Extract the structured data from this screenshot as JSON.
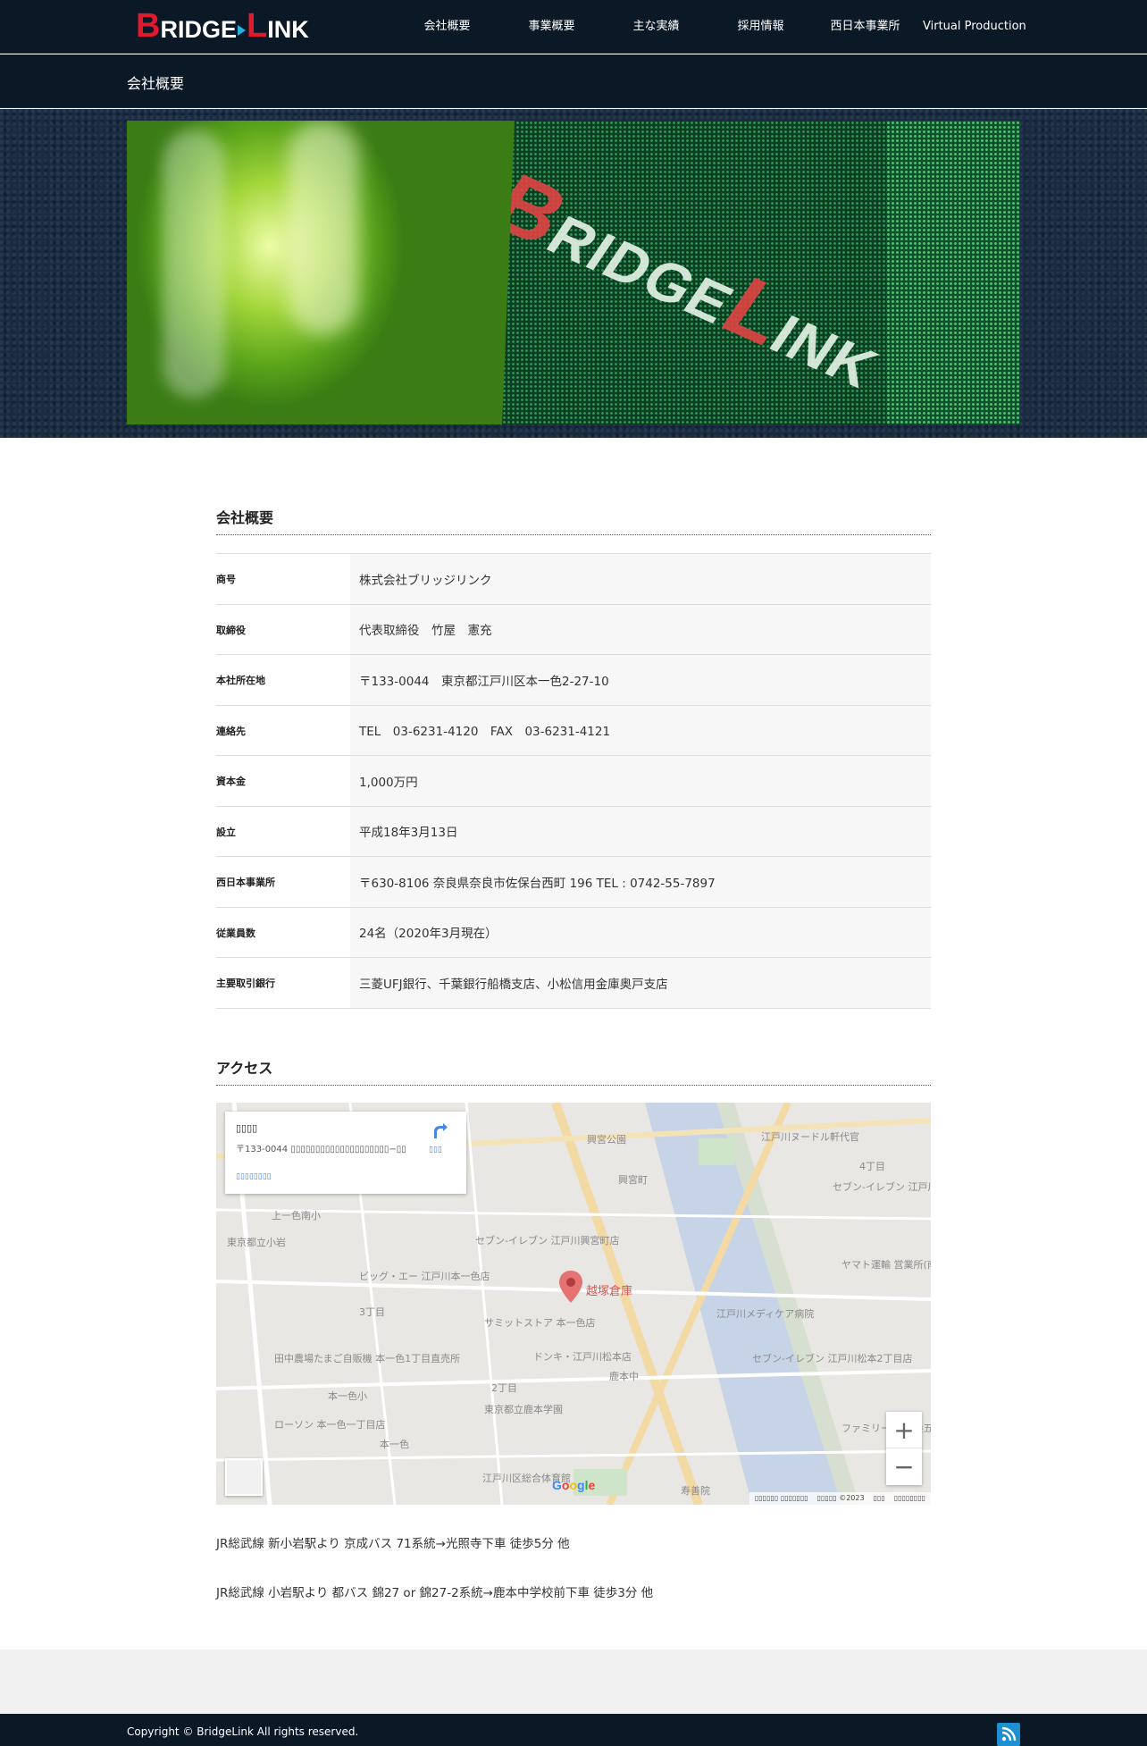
{
  "header": {
    "logo_text": "BridgeLink",
    "nav": [
      {
        "label": "会社概要"
      },
      {
        "label": "事業概要"
      },
      {
        "label": "主な実績"
      },
      {
        "label": "採用情報"
      },
      {
        "label": "西日本事業所"
      },
      {
        "label": "Virtual Production"
      }
    ]
  },
  "page_title": "会社概要",
  "company": {
    "heading": "会社概要",
    "rows": [
      {
        "label": "商号",
        "value": "株式会社ブリッジリンク"
      },
      {
        "label": "取締役",
        "value": "代表取締役　竹屋　憲充"
      },
      {
        "label": "本社所在地",
        "value": "〒133-0044　東京都江戸川区本一色2-27-10"
      },
      {
        "label": "連絡先",
        "value": "TEL　03-6231-4120　FAX　03-6231-4121"
      },
      {
        "label": "資本金",
        "value": "1,000万円"
      },
      {
        "label": "設立",
        "value": "平成18年3月13日"
      },
      {
        "label": "西日本事業所",
        "value": "〒630-8106 奈良県奈良市佐保台西町 196 TEL : 0742-55-7897"
      },
      {
        "label": "従業員数",
        "value": "24名（2020年3月現在）"
      },
      {
        "label": "主要取引銀行",
        "value": "三菱UFJ銀行、千葉銀行船橋支店、小松信用金庫奥戸支店"
      }
    ]
  },
  "access": {
    "heading": "アクセス",
    "map": {
      "place_name": "▯▯▯▯",
      "address": "〒133-0044 ▯▯▯▯▯▯▯▯▯▯▯▯▯▯▯▯▯▯▯▯−▯▯",
      "directions_label": "▯▯▯",
      "larger_map_label": "▯▯▯▯▯▯▯▯",
      "pin_label": "越塚倉庫",
      "zoom_in": "+",
      "zoom_out": "−",
      "google_logo": "Google",
      "attribution": [
        "▯▯▯▯▯▯ ▯▯▯▯▯▯▯",
        "▯▯▯▯▯ ©2023",
        "▯▯▯",
        "▯▯▯▯▯▯▯▯"
      ],
      "labels": [
        {
          "text": "興宮公園"
        },
        {
          "text": "興宮町"
        },
        {
          "text": "江戸川ヌードル軒代官"
        },
        {
          "text": "4丁目"
        },
        {
          "text": "セブン-イレブン 江戸川二枚橋店"
        },
        {
          "text": "上一色南小"
        },
        {
          "text": "東京都立小岩"
        },
        {
          "text": "セブン-イレブン 江戸川興宮町店"
        },
        {
          "text": "ビッグ・エー 江戸川本一色店"
        },
        {
          "text": "ヤマト運輸 営業所(南小"
        },
        {
          "text": "3丁目"
        },
        {
          "text": "サミットストア 本一色店"
        },
        {
          "text": "江戸川メディケア病院"
        },
        {
          "text": "田中農場たまご自販機 本一色1丁目直売所"
        },
        {
          "text": "ドンキ・江戸川松本店"
        },
        {
          "text": "鹿本中"
        },
        {
          "text": "セブン-イレブン 江戸川松本2丁目店"
        },
        {
          "text": "本一色小"
        },
        {
          "text": "2丁目"
        },
        {
          "text": "東京都立鹿本学園"
        },
        {
          "text": "ローソン 本一色一丁目店"
        },
        {
          "text": "本一色"
        },
        {
          "text": "ファミリーマ 要養五丁"
        },
        {
          "text": "江戸川区総合体育館"
        },
        {
          "text": "寿善院"
        }
      ]
    },
    "directions": [
      "JR総武線 新小岩駅より 京成バス 71系統→光照寺下車 徒歩5分 他",
      "JR総武線 小岩駅より 都バス 錦27 or 錦27-2系統→鹿本中学校前下車 徒歩3分 他"
    ]
  },
  "footer": {
    "copyright": "Copyright ©  BridgeLink All rights reserved.",
    "rss_icon": "rss-icon"
  },
  "colors": {
    "header_bg": "#0b1826",
    "brand_red": "#e0192e",
    "brand_cyan": "#23b3e0",
    "link_blue": "#4a86e8"
  }
}
